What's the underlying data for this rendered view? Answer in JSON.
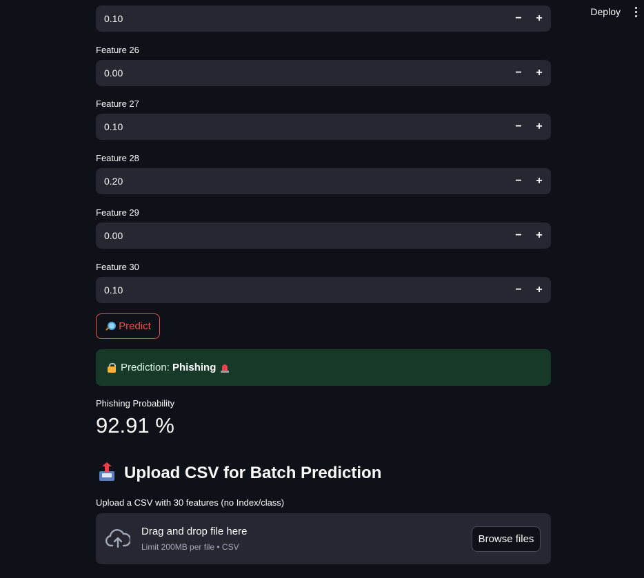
{
  "header": {
    "deploy_label": "Deploy",
    "menu_icon": "kebab-menu-icon"
  },
  "fields": [
    {
      "label": "",
      "value": "0.10"
    },
    {
      "label": "Feature 26",
      "value": "0.00"
    },
    {
      "label": "Feature 27",
      "value": "0.10"
    },
    {
      "label": "Feature 28",
      "value": "0.20"
    },
    {
      "label": "Feature 29",
      "value": "0.00"
    },
    {
      "label": "Feature 30",
      "value": "0.10"
    }
  ],
  "stepper": {
    "minus": "−",
    "plus": "+"
  },
  "predict": {
    "label": "Predict",
    "icon": "magnifier-icon",
    "color": "#ff4b4b"
  },
  "result": {
    "prefix": "Prediction: ",
    "value": "Phishing",
    "background": "#173928"
  },
  "metric": {
    "label": "Phishing Probability",
    "value": "92.91 %"
  },
  "upload": {
    "title": "Upload CSV for Batch Prediction",
    "field_label": "Upload a CSV with 30 features (no Index/class)",
    "drop_text": "Drag and drop file here",
    "limit_text": "Limit 200MB per file • CSV",
    "browse_label": "Browse files"
  }
}
